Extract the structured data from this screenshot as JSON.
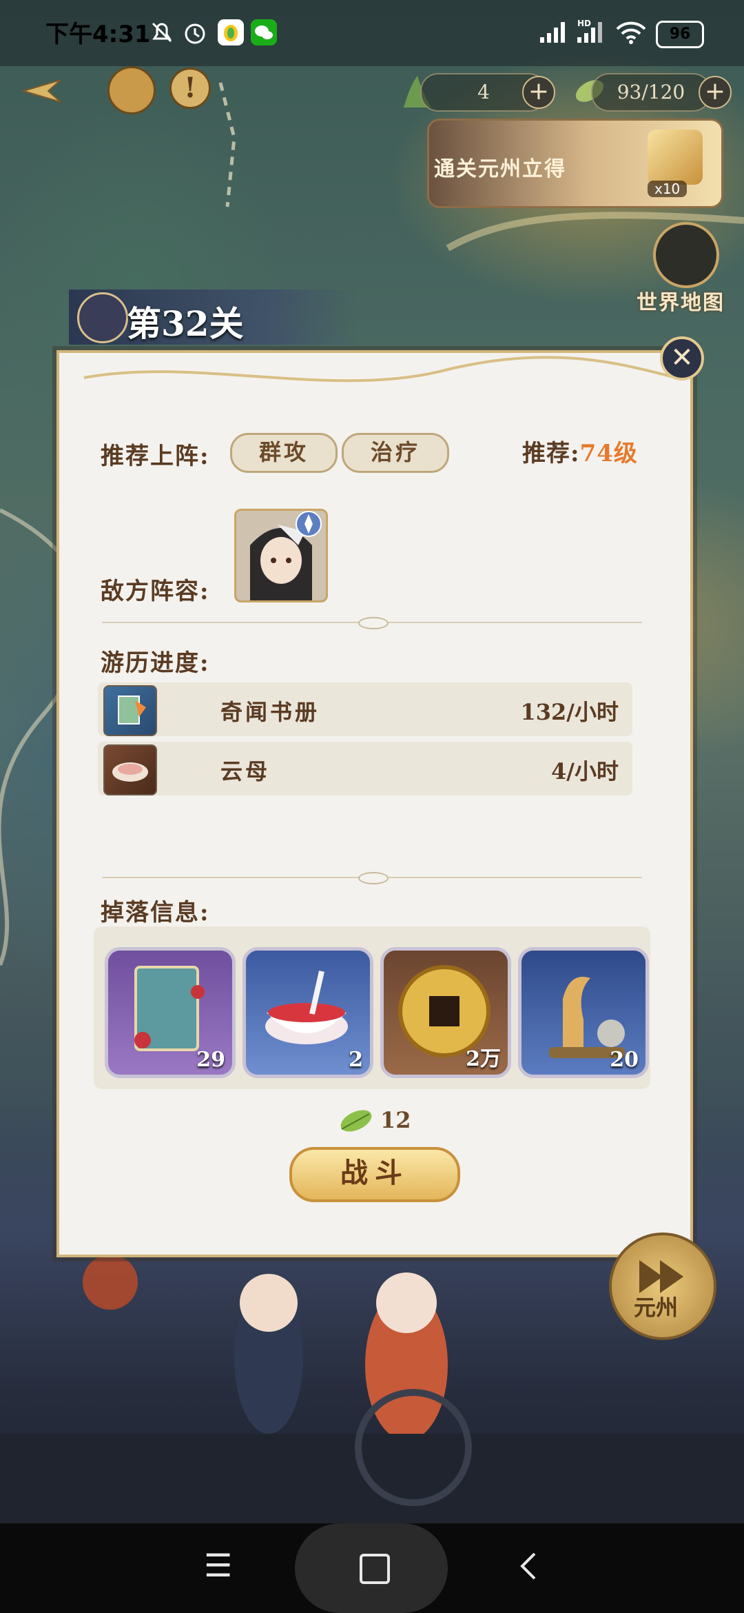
{
  "status_bar": {
    "time": "下午4:31",
    "battery": "96",
    "icons": [
      "mute-icon",
      "alarm-icon",
      "app-icon",
      "wechat-icon",
      "signal-icon",
      "hd-signal-icon",
      "wifi-icon"
    ]
  },
  "hud": {
    "resource_1": "4",
    "resource_2": "93/120",
    "reward_banner": "通关元州立得",
    "reward_count": "x10",
    "world_map_label": "世界地图"
  },
  "dialog": {
    "stage_title": "第32关",
    "recommend_label": "推荐上阵:",
    "recommend_tags": [
      "群攻",
      "治疗"
    ],
    "recommend_level_prefix": "推荐:",
    "recommend_level_value": "74级",
    "enemy_label": "敌方阵容:",
    "progress_label": "游历进度:",
    "progress_items": [
      {
        "name": "奇闻书册",
        "rate": "132/小时"
      },
      {
        "name": "云母",
        "rate": "4/小时"
      }
    ],
    "drop_label": "掉落信息:",
    "drops": [
      {
        "icon": "scroll-book-icon",
        "count": "29"
      },
      {
        "icon": "red-bowl-icon",
        "count": "2"
      },
      {
        "icon": "gold-coin-icon",
        "count": "2万"
      },
      {
        "icon": "crane-incense-icon",
        "count": "20"
      }
    ],
    "stamina_cost": "12",
    "battle_button": "战斗"
  },
  "next_area_label": "元州",
  "colors": {
    "accent_gold": "#d2b57a",
    "level_orange": "#e57a2e",
    "text_brown": "#5a3b22"
  }
}
